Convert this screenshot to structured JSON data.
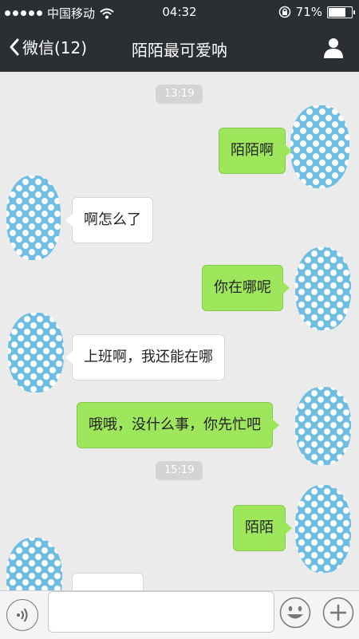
{
  "status_bar": {
    "carrier": "中国移动",
    "time": "04:32",
    "battery": "71%",
    "battery_level": 0.71
  },
  "nav": {
    "back_label": "微信(12)",
    "title": "陌陌最可爱呐"
  },
  "messages": {
    "ts1": "13:19",
    "m1": "陌陌啊",
    "m2": "啊怎么了",
    "m3": "你在哪呢",
    "m4": "上班啊，我还能在哪",
    "m5": "哦哦，没什么事，你先忙吧",
    "ts2": "15:19",
    "m6": "陌陌"
  },
  "input": {
    "value": ""
  },
  "colors": {
    "bar_bg": "#2b2f33",
    "chat_bg": "#ebebeb",
    "my_bubble": "#9ee65b",
    "their_bubble": "#ffffff",
    "avatar_blue": "#6fbde3"
  },
  "icons": {
    "back": "chevron-left-icon",
    "profile": "person-icon",
    "voice": "voice-icon",
    "emoji": "smiley-icon",
    "more": "plus-icon",
    "signal": "signal-dots-icon",
    "wifi": "wifi-icon",
    "rotation_lock": "rotation-lock-icon",
    "battery": "battery-icon"
  }
}
